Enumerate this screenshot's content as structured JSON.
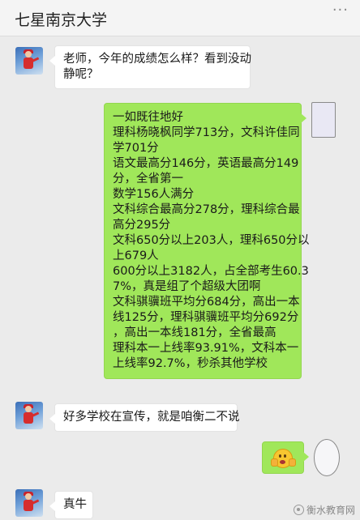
{
  "header": {
    "title": "七星南京大学",
    "more_icon": "more-dots-icon"
  },
  "messages": [
    {
      "side": "left",
      "lines": [
        "老师，今年的成绩怎么样？看到没动",
        "静呢？"
      ]
    },
    {
      "side": "right",
      "lines": [
        "一如既往地好",
        "理科杨晓枫同学713分，文科许佳同",
        "学701分",
        "语文最高分146分，英语最高分149",
        "分，全省第一",
        "数学156人满分",
        "文科综合最高分278分，理科综合最",
        "高分295分",
        "文科650分以上203人，理科650分以",
        "上679人",
        "600分以上3182人，占全部考生60.3",
        "7%，真是组了个超级大团啊",
        "文科骐骥班平均分684分，高出一本",
        "线125分，理科骐骥班平均分692分",
        "，高出一本线181分，全省最高",
        "理科本一上线率93.91%，文科本一",
        "上线率92.7%，秒杀其他学校"
      ]
    },
    {
      "side": "left",
      "lines": [
        "好多学校在宣传，就是咱衡二不说"
      ]
    },
    {
      "side": "right",
      "emoji": "surprised-face-emoji"
    },
    {
      "side": "left",
      "lines": [
        "真牛"
      ]
    }
  ],
  "watermark": {
    "text": "衡水教育网"
  }
}
